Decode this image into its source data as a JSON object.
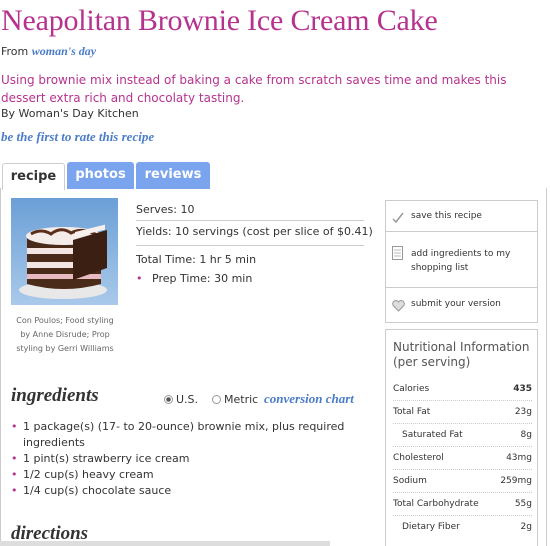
{
  "header": {
    "title": "Neapolitan Brownie Ice Cream Cake",
    "from_label": "From",
    "from_source": "woman's day",
    "description": "Using brownie mix instead of baking a cake from scratch saves time and makes this dessert extra rich and chocolaty tasting.",
    "byline": "By Woman's Day Kitchen",
    "rate_link": "be the first to rate this recipe"
  },
  "tabs": [
    {
      "label": "recipe",
      "active": true
    },
    {
      "label": "photos",
      "active": false
    },
    {
      "label": "reviews",
      "active": false
    }
  ],
  "photo": {
    "caption": "Con Poulos; Food styling by Anne Disrude; Prop styling by Gerri Williams"
  },
  "meta": {
    "serves_label": "Serves:",
    "serves_value": "10",
    "yields_label": "Yields:",
    "yields_value": "10 servings (cost per slice of $0.41)",
    "total_label": "Total Time:",
    "total_value": "1 hr 5 min",
    "prep_label": "Prep Time:",
    "prep_value": "30 min"
  },
  "actions": {
    "save": "save this recipe",
    "shopping": "add ingredients to my shopping list",
    "submit": "submit your version"
  },
  "nutrition": {
    "title": "Nutritional Information (per serving)",
    "rows": [
      {
        "label": "Calories",
        "value": "435",
        "sub": false
      },
      {
        "label": "Total Fat",
        "value": "23g",
        "sub": false
      },
      {
        "label": "Saturated Fat",
        "value": "8g",
        "sub": true
      },
      {
        "label": "Cholesterol",
        "value": "43mg",
        "sub": false
      },
      {
        "label": "Sodium",
        "value": "259mg",
        "sub": false
      },
      {
        "label": "Total Carbohydrate",
        "value": "55g",
        "sub": false
      },
      {
        "label": "Dietary Fiber",
        "value": "2g",
        "sub": true
      }
    ]
  },
  "ingredients": {
    "heading": "ingredients",
    "unit_us": "U.S.",
    "unit_metric": "Metric",
    "conversion": "conversion chart",
    "items": [
      "1 package(s) (17- to 20-ounce) brownie mix, plus required ingredients",
      "1 pint(s) strawberry ice cream",
      "1/2 cup(s) heavy cream",
      "1/4 cup(s) chocolate sauce"
    ]
  },
  "directions": {
    "heading": "directions"
  }
}
